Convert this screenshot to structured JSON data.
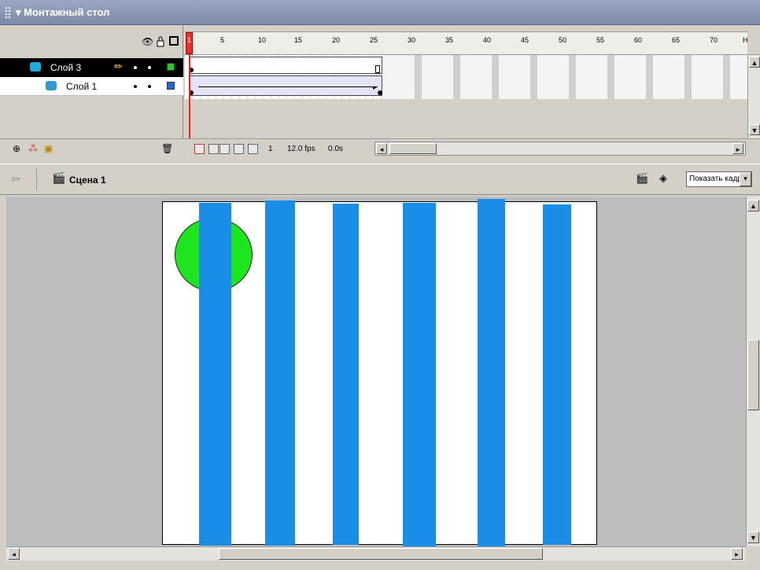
{
  "panel": {
    "title": "▾ Монтажный стол"
  },
  "header_icons": {
    "eye": "eye-icon",
    "lock": "lock-icon",
    "outline": "outline-icon"
  },
  "ruler": {
    "labels": [
      "1",
      "5",
      "10",
      "15",
      "20",
      "25",
      "30",
      "35",
      "40",
      "45",
      "50",
      "55",
      "60",
      "65",
      "70",
      "H"
    ]
  },
  "layers": [
    {
      "name": "Слой 3",
      "selected": true,
      "color": "#22cc22",
      "icon": "layer-icon"
    },
    {
      "name": "Слой 1",
      "selected": false,
      "color": "#2266dd",
      "icon": "motion-guide-icon"
    }
  ],
  "timeline_status": {
    "current_frame": "1",
    "fps": "12.0 fps",
    "time": "0.0s"
  },
  "scene": {
    "label": "Сцена 1",
    "zoom": "Показать кадр"
  },
  "colors": {
    "stripe": "#1a8ee6",
    "circle": "#1ee61e",
    "playhead": "#f02020",
    "stage_bg": "#ffffff",
    "workspace": "#bdbdbd"
  }
}
